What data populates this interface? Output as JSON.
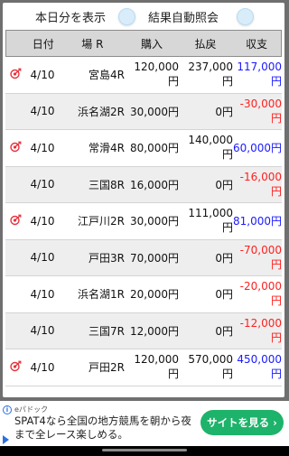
{
  "toggles": {
    "show_today_label": "本日分を表示",
    "auto_result_label": "結果自動照会"
  },
  "header": {
    "date": "日付",
    "venue": "場 R",
    "bet": "購入",
    "payout": "払戻",
    "balance": "収支"
  },
  "rows": [
    {
      "hit": true,
      "date": "4/10",
      "venue": "宮島4R",
      "bet": "120,000円",
      "payout": "237,000円",
      "balance": "117,000円",
      "balance_color": "#1a1aff"
    },
    {
      "hit": false,
      "date": "4/10",
      "venue": "浜名湖2R",
      "bet": "30,000円",
      "payout": "0円",
      "balance": "-30,000円",
      "balance_color": "#ff2020"
    },
    {
      "hit": true,
      "date": "4/10",
      "venue": "常滑4R",
      "bet": "80,000円",
      "payout": "140,000円",
      "balance": "60,000円",
      "balance_color": "#1a1aff"
    },
    {
      "hit": false,
      "date": "4/10",
      "venue": "三国8R",
      "bet": "16,000円",
      "payout": "0円",
      "balance": "-16,000円",
      "balance_color": "#ff2020"
    },
    {
      "hit": true,
      "date": "4/10",
      "venue": "江戸川2R",
      "bet": "30,000円",
      "payout": "111,000円",
      "balance": "81,000円",
      "balance_color": "#1a1aff"
    },
    {
      "hit": false,
      "date": "4/10",
      "venue": "戸田3R",
      "bet": "70,000円",
      "payout": "0円",
      "balance": "-70,000円",
      "balance_color": "#ff2020"
    },
    {
      "hit": false,
      "date": "4/10",
      "venue": "浜名湖1R",
      "bet": "20,000円",
      "payout": "0円",
      "balance": "-20,000円",
      "balance_color": "#ff2020"
    },
    {
      "hit": false,
      "date": "4/10",
      "venue": "三国7R",
      "bet": "12,000円",
      "payout": "0円",
      "balance": "-12,000円",
      "balance_color": "#ff2020"
    },
    {
      "hit": true,
      "date": "4/10",
      "venue": "戸田2R",
      "bet": "120,000円",
      "payout": "570,000円",
      "balance": "450,000円",
      "balance_color": "#1a1aff"
    }
  ],
  "ad": {
    "brand": "eパドック",
    "text": "SPAT4なら全国の地方競馬を朝から夜まで全レース楽しめる。",
    "cta": "サイトを見る ›"
  },
  "icons": {
    "hit": "target-dart-icon",
    "toggle": "toggle-knob",
    "ad_info": "info-icon",
    "ad_play": "play-icon"
  },
  "colors": {
    "positive": "#1a1aff",
    "negative": "#ff2020",
    "hit_icon": "#e8323c",
    "cta": "#1db36a",
    "header_bg": "#d7d7d7",
    "alt_row": "#eeeeee"
  }
}
